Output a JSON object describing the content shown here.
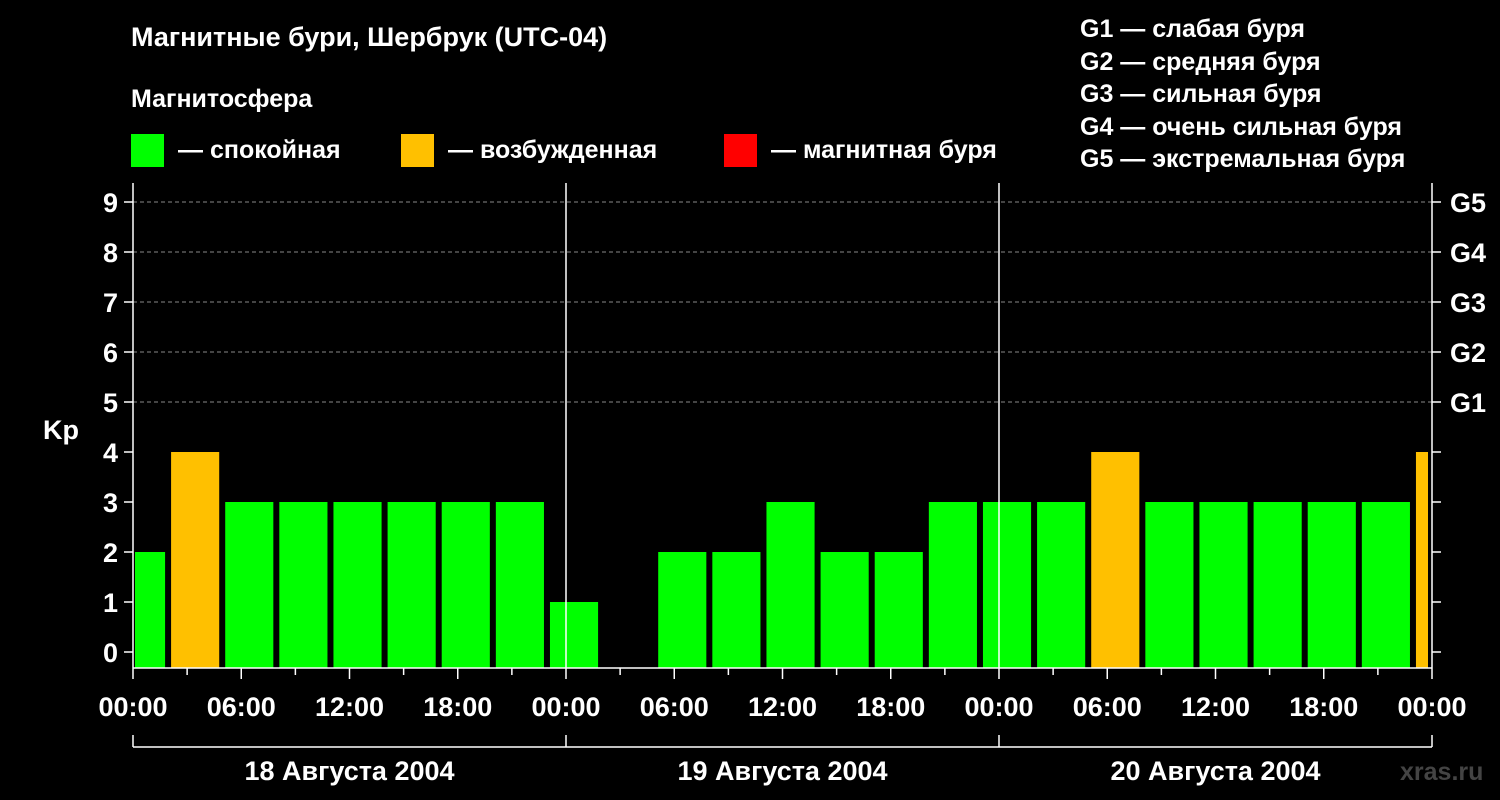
{
  "header": {
    "title": "Магнитные бури, Шербрук (UTC-04)",
    "subtitle": "Магнитосфера"
  },
  "legend": [
    {
      "label": "— спокойная",
      "color": "#00ff00"
    },
    {
      "label": "— возбужденная",
      "color": "#ffc000"
    },
    {
      "label": "— магнитная буря",
      "color": "#ff0000"
    }
  ],
  "g_scale": [
    "G1 — слабая буря",
    "G2 — средняя буря",
    "G3 — сильная буря",
    "G4 — очень сильная буря",
    "G5 — экстремальная буря"
  ],
  "watermark": "xras.ru",
  "chart_data": {
    "type": "bar",
    "ylabel": "Kp",
    "ylim": [
      0,
      9
    ],
    "y_ticks": [
      "0",
      "1",
      "2",
      "3",
      "4",
      "5",
      "6",
      "7",
      "8",
      "9"
    ],
    "right_ticks": [
      {
        "kp": 5,
        "label": "G1"
      },
      {
        "kp": 6,
        "label": "G2"
      },
      {
        "kp": 7,
        "label": "G3"
      },
      {
        "kp": 8,
        "label": "G4"
      },
      {
        "kp": 9,
        "label": "G5"
      }
    ],
    "grid": "dashed horizontal lines at Kp 5–9",
    "x_range_hours": [
      0,
      72
    ],
    "x_ticks": [
      "00:00",
      "06:00",
      "12:00",
      "18:00",
      "00:00",
      "06:00",
      "12:00",
      "18:00",
      "00:00",
      "06:00",
      "12:00",
      "18:00",
      "00:00"
    ],
    "days": [
      "18 Августа 2004",
      "19 Августа 2004",
      "20 Августа 2004"
    ],
    "bars": [
      {
        "start": 0,
        "end": 2,
        "kp": 2,
        "level": "quiet"
      },
      {
        "start": 2,
        "end": 5,
        "kp": 4,
        "level": "active"
      },
      {
        "start": 5,
        "end": 8,
        "kp": 3,
        "level": "quiet"
      },
      {
        "start": 8,
        "end": 11,
        "kp": 3,
        "level": "quiet"
      },
      {
        "start": 11,
        "end": 14,
        "kp": 3,
        "level": "quiet"
      },
      {
        "start": 14,
        "end": 17,
        "kp": 3,
        "level": "quiet"
      },
      {
        "start": 17,
        "end": 20,
        "kp": 3,
        "level": "quiet"
      },
      {
        "start": 20,
        "end": 23,
        "kp": 3,
        "level": "quiet"
      },
      {
        "start": 23,
        "end": 26,
        "kp": 1,
        "level": "quiet"
      },
      {
        "start": 29,
        "end": 32,
        "kp": 2,
        "level": "quiet"
      },
      {
        "start": 32,
        "end": 35,
        "kp": 2,
        "level": "quiet"
      },
      {
        "start": 35,
        "end": 38,
        "kp": 3,
        "level": "quiet"
      },
      {
        "start": 38,
        "end": 41,
        "kp": 2,
        "level": "quiet"
      },
      {
        "start": 41,
        "end": 44,
        "kp": 2,
        "level": "quiet"
      },
      {
        "start": 44,
        "end": 47,
        "kp": 3,
        "level": "quiet"
      },
      {
        "start": 47,
        "end": 50,
        "kp": 3,
        "level": "quiet"
      },
      {
        "start": 50,
        "end": 53,
        "kp": 3,
        "level": "quiet"
      },
      {
        "start": 53,
        "end": 56,
        "kp": 4,
        "level": "active"
      },
      {
        "start": 56,
        "end": 59,
        "kp": 3,
        "level": "quiet"
      },
      {
        "start": 59,
        "end": 62,
        "kp": 3,
        "level": "quiet"
      },
      {
        "start": 62,
        "end": 65,
        "kp": 3,
        "level": "quiet"
      },
      {
        "start": 65,
        "end": 68,
        "kp": 3,
        "level": "quiet"
      },
      {
        "start": 68,
        "end": 71,
        "kp": 3,
        "level": "quiet"
      },
      {
        "start": 71,
        "end": 72,
        "kp": 4,
        "level": "active"
      }
    ],
    "colors": {
      "quiet": "#00ff00",
      "active": "#ffc000",
      "storm": "#ff0000"
    }
  }
}
